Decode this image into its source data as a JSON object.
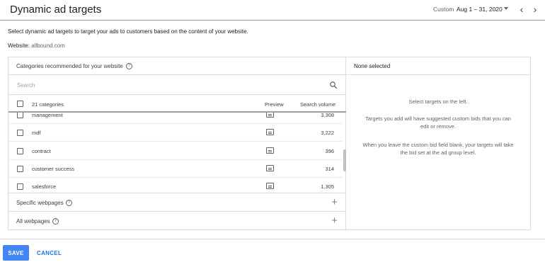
{
  "header": {
    "title": "Dynamic ad targets",
    "date_label": "Custom",
    "date_range": "Aug 1 – 31, 2020",
    "prev_arrow": "‹",
    "next_arrow": "›"
  },
  "intro_text": "Select dynamic ad targets to target your ads to customers based on the content of your website.",
  "website": {
    "label": "Website:",
    "value": "allbound.com"
  },
  "categories": {
    "title": "Categories recommended for your website",
    "search_placeholder": "Search",
    "header": {
      "count": "21 categories",
      "preview": "Preview",
      "volume": "Search volume"
    },
    "rows": [
      {
        "name": "management",
        "volume": "3,308"
      },
      {
        "name": "mdf",
        "volume": "3,222"
      },
      {
        "name": "contract",
        "volume": "396"
      },
      {
        "name": "customer success",
        "volume": "314"
      },
      {
        "name": "salesforce",
        "volume": "1,305"
      }
    ]
  },
  "sections": [
    {
      "label": "Specific webpages"
    },
    {
      "label": "All webpages"
    }
  ],
  "selected_panel": {
    "title": "None selected",
    "line1": "Select targets on the left.",
    "line2": "Targets you add will have suggested custom bids that you can edit or remove.",
    "line3": "When you leave the custom bid field blank, your targets will take the bid set at the ad group level."
  },
  "footer": {
    "save": "SAVE",
    "cancel": "CANCEL"
  },
  "colors": {
    "primary": "#4285f4",
    "link": "#1a73e8",
    "border": "#dadce0"
  },
  "icons": {
    "help": "help-circle-icon",
    "search": "search-icon",
    "preview": "preview-icon",
    "plus": "plus-icon",
    "caret": "caret-down-icon"
  }
}
